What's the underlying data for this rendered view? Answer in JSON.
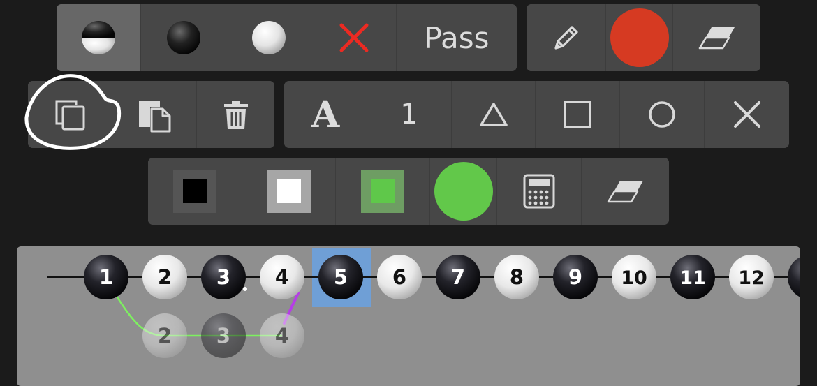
{
  "toolbar_top": {
    "stone_modes": [
      {
        "id": "alternate",
        "icon": "half-stone-icon",
        "active": true
      },
      {
        "id": "black",
        "icon": "black-stone-icon",
        "active": false
      },
      {
        "id": "white",
        "icon": "white-stone-icon",
        "active": false
      },
      {
        "id": "remove",
        "icon": "red-x-icon",
        "active": false
      }
    ],
    "pass_label": "Pass",
    "draw_tools": [
      {
        "id": "pencil",
        "icon": "pencil-icon"
      },
      {
        "id": "color",
        "icon": "color-swatch-icon",
        "color": "#d63a22"
      },
      {
        "id": "eraser",
        "icon": "eraser-icon"
      }
    ]
  },
  "toolbar_edit": {
    "items": [
      {
        "id": "copy",
        "icon": "copy-icon"
      },
      {
        "id": "paste",
        "icon": "paste-icon"
      },
      {
        "id": "delete",
        "icon": "trash-icon"
      }
    ]
  },
  "toolbar_marks": {
    "letter_label": "A",
    "number_label": "1",
    "items": [
      {
        "id": "triangle",
        "icon": "triangle-icon"
      },
      {
        "id": "square",
        "icon": "square-icon"
      },
      {
        "id": "circle",
        "icon": "circle-icon"
      },
      {
        "id": "cross",
        "icon": "x-mark-icon"
      }
    ]
  },
  "toolbar_color": {
    "swatches": [
      {
        "id": "black",
        "fill": "#000000",
        "frame": "#555555"
      },
      {
        "id": "white",
        "fill": "#ffffff",
        "frame": "#a6a6a6"
      },
      {
        "id": "green",
        "fill": "#5fc84a",
        "frame": "#6e9d63"
      }
    ],
    "current_color": "#62c84a",
    "tools": [
      {
        "id": "calculator",
        "icon": "calculator-icon"
      },
      {
        "id": "eraser",
        "icon": "eraser-icon"
      }
    ]
  },
  "move_tree": {
    "main_line": [
      {
        "label": "1",
        "color": "black"
      },
      {
        "label": "2",
        "color": "white"
      },
      {
        "label": "3",
        "color": "black"
      },
      {
        "label": "4",
        "color": "white"
      },
      {
        "label": "5",
        "color": "black",
        "selected": true
      },
      {
        "label": "6",
        "color": "white"
      },
      {
        "label": "7",
        "color": "black"
      },
      {
        "label": "8",
        "color": "white"
      },
      {
        "label": "9",
        "color": "black"
      },
      {
        "label": "10",
        "color": "white"
      },
      {
        "label": "11",
        "color": "black"
      },
      {
        "label": "12",
        "color": "white"
      }
    ],
    "variation": [
      {
        "label": "2",
        "color": "white"
      },
      {
        "label": "3",
        "color": "black"
      },
      {
        "label": "4",
        "color": "white"
      }
    ],
    "selection_color": "#6f9fd6",
    "variation_line_color": "#7ef060",
    "accent_line_color": "#b53ee6"
  }
}
